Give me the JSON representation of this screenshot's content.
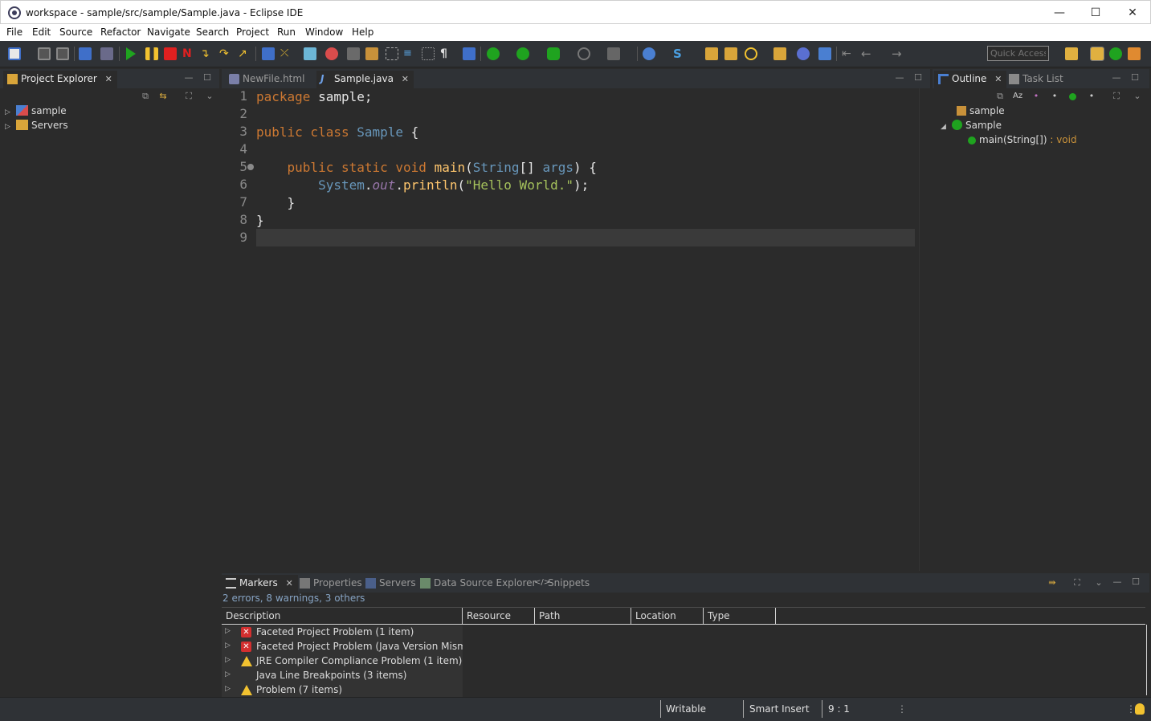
{
  "window": {
    "title": "workspace - sample/src/sample/Sample.java - Eclipse IDE",
    "minimize_glyph": "—",
    "maximize_glyph": "☐",
    "close_glyph": "✕"
  },
  "menubar": {
    "items": [
      "File",
      "Edit",
      "Source",
      "Refactor",
      "Navigate",
      "Search",
      "Project",
      "Run",
      "Window",
      "Help"
    ]
  },
  "toolbar": {
    "quick_access_placeholder": "Quick Access"
  },
  "project_explorer": {
    "tab_label": "Project Explorer",
    "items": [
      {
        "label": "sample",
        "icon": "java-project-icon"
      },
      {
        "label": "Servers",
        "icon": "folder-icon"
      }
    ]
  },
  "editor": {
    "tabs": [
      {
        "label": "NewFile.html",
        "active": false
      },
      {
        "label": "Sample.java",
        "active": true
      }
    ],
    "line_numbers": [
      "1",
      "2",
      "3",
      "4",
      "5",
      "6",
      "7",
      "8",
      "9"
    ],
    "code": {
      "l1_kw": "package",
      "l1_rest": " sample;",
      "l3_kw": "public class",
      "l3_type": "Sample",
      "l3_rest": " {",
      "l5_kw": "public static void",
      "l5_fn": "main",
      "l5_open": "(",
      "l5_type": "String",
      "l5_mid": "[] ",
      "l5_arg": "args",
      "l5_rest": ") {",
      "l6_type": "System",
      "l6_dot1": ".",
      "l6_field": "out",
      "l6_dot2": ".",
      "l6_fn": "println",
      "l6_open": "(",
      "l6_str": "\"Hello World.\"",
      "l6_rest": ");",
      "l7": "}",
      "l8": "}"
    }
  },
  "outline": {
    "tabs": [
      {
        "label": "Outline",
        "active": true
      },
      {
        "label": "Task List",
        "active": false
      }
    ],
    "items": [
      {
        "label": "sample"
      },
      {
        "label": "Sample"
      },
      {
        "label": "main(String[])",
        "suffix": " : void"
      }
    ]
  },
  "markers": {
    "tabs": [
      "Markers",
      "Properties",
      "Servers",
      "Data Source Explorer",
      "Snippets"
    ],
    "summary": "2 errors, 8 warnings, 3 others",
    "columns": [
      "Description",
      "Resource",
      "Path",
      "Location",
      "Type"
    ],
    "rows": [
      {
        "label": "Faceted Project Problem (1 item)",
        "icon": "error"
      },
      {
        "label": "Faceted Project Problem (Java Version Mismatch",
        "icon": "error"
      },
      {
        "label": "JRE Compiler Compliance Problem (1 item)",
        "icon": "warning"
      },
      {
        "label": "Java Line Breakpoints (3 items)",
        "icon": "none"
      },
      {
        "label": "Problem (7 items)",
        "icon": "warning"
      }
    ]
  },
  "statusbar": {
    "writable": "Writable",
    "insert_mode": "Smart Insert",
    "position": "9 : 1"
  },
  "colors": {
    "accent_error": "#d32f2f",
    "accent_warning": "#f2c230",
    "run_green": "#1fa31f"
  }
}
